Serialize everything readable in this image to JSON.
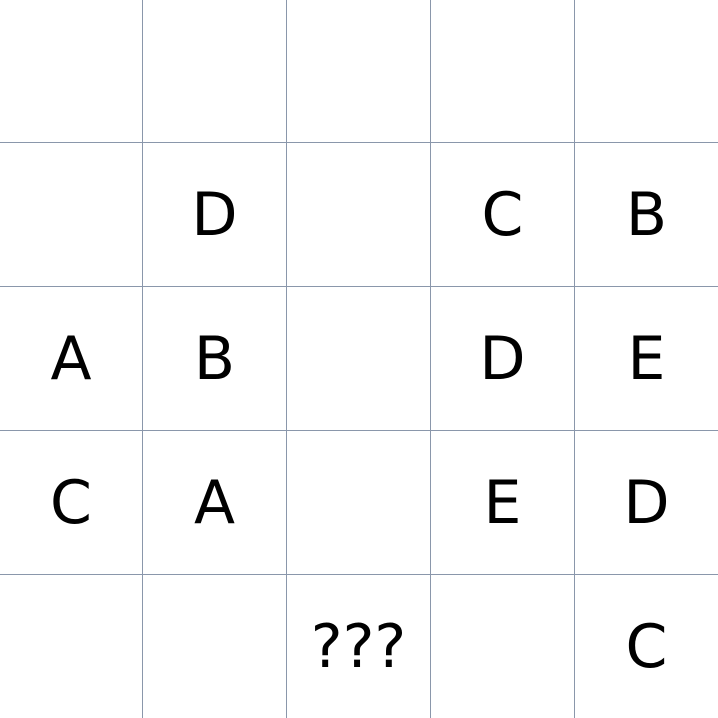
{
  "grid": {
    "rows": [
      [
        "",
        "",
        "",
        "",
        ""
      ],
      [
        "",
        "D",
        "",
        "C",
        "B"
      ],
      [
        "A",
        "B",
        "",
        "D",
        "E"
      ],
      [
        "C",
        "A",
        "",
        "E",
        "D"
      ],
      [
        "",
        "",
        "???",
        "",
        "C"
      ]
    ]
  },
  "colors": {
    "grid_line": "#8a97ab",
    "text": "#000000",
    "background": "#ffffff"
  }
}
